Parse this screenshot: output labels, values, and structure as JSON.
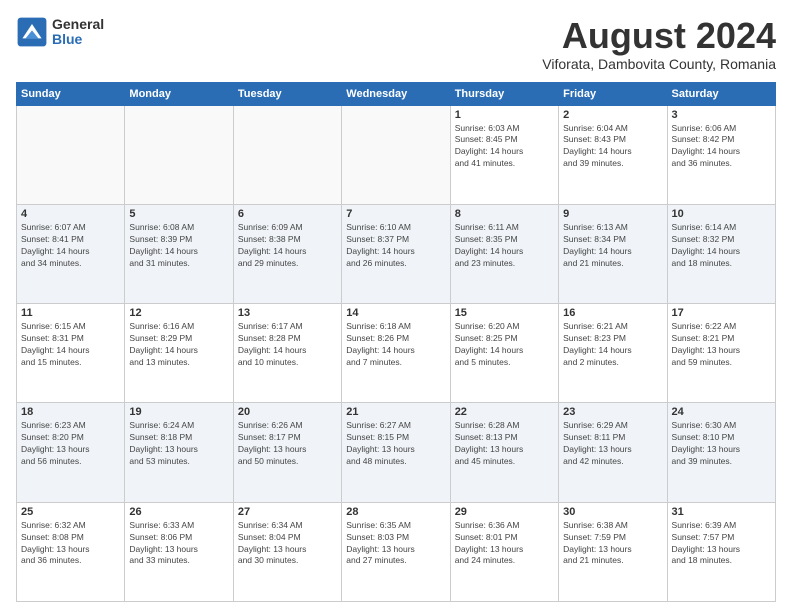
{
  "logo": {
    "general": "General",
    "blue": "Blue"
  },
  "title": "August 2024",
  "subtitle": "Viforata, Dambovita County, Romania",
  "weekdays": [
    "Sunday",
    "Monday",
    "Tuesday",
    "Wednesday",
    "Thursday",
    "Friday",
    "Saturday"
  ],
  "weeks": [
    [
      {
        "day": "",
        "info": ""
      },
      {
        "day": "",
        "info": ""
      },
      {
        "day": "",
        "info": ""
      },
      {
        "day": "",
        "info": ""
      },
      {
        "day": "1",
        "info": "Sunrise: 6:03 AM\nSunset: 8:45 PM\nDaylight: 14 hours\nand 41 minutes."
      },
      {
        "day": "2",
        "info": "Sunrise: 6:04 AM\nSunset: 8:43 PM\nDaylight: 14 hours\nand 39 minutes."
      },
      {
        "day": "3",
        "info": "Sunrise: 6:06 AM\nSunset: 8:42 PM\nDaylight: 14 hours\nand 36 minutes."
      }
    ],
    [
      {
        "day": "4",
        "info": "Sunrise: 6:07 AM\nSunset: 8:41 PM\nDaylight: 14 hours\nand 34 minutes."
      },
      {
        "day": "5",
        "info": "Sunrise: 6:08 AM\nSunset: 8:39 PM\nDaylight: 14 hours\nand 31 minutes."
      },
      {
        "day": "6",
        "info": "Sunrise: 6:09 AM\nSunset: 8:38 PM\nDaylight: 14 hours\nand 29 minutes."
      },
      {
        "day": "7",
        "info": "Sunrise: 6:10 AM\nSunset: 8:37 PM\nDaylight: 14 hours\nand 26 minutes."
      },
      {
        "day": "8",
        "info": "Sunrise: 6:11 AM\nSunset: 8:35 PM\nDaylight: 14 hours\nand 23 minutes."
      },
      {
        "day": "9",
        "info": "Sunrise: 6:13 AM\nSunset: 8:34 PM\nDaylight: 14 hours\nand 21 minutes."
      },
      {
        "day": "10",
        "info": "Sunrise: 6:14 AM\nSunset: 8:32 PM\nDaylight: 14 hours\nand 18 minutes."
      }
    ],
    [
      {
        "day": "11",
        "info": "Sunrise: 6:15 AM\nSunset: 8:31 PM\nDaylight: 14 hours\nand 15 minutes."
      },
      {
        "day": "12",
        "info": "Sunrise: 6:16 AM\nSunset: 8:29 PM\nDaylight: 14 hours\nand 13 minutes."
      },
      {
        "day": "13",
        "info": "Sunrise: 6:17 AM\nSunset: 8:28 PM\nDaylight: 14 hours\nand 10 minutes."
      },
      {
        "day": "14",
        "info": "Sunrise: 6:18 AM\nSunset: 8:26 PM\nDaylight: 14 hours\nand 7 minutes."
      },
      {
        "day": "15",
        "info": "Sunrise: 6:20 AM\nSunset: 8:25 PM\nDaylight: 14 hours\nand 5 minutes."
      },
      {
        "day": "16",
        "info": "Sunrise: 6:21 AM\nSunset: 8:23 PM\nDaylight: 14 hours\nand 2 minutes."
      },
      {
        "day": "17",
        "info": "Sunrise: 6:22 AM\nSunset: 8:21 PM\nDaylight: 13 hours\nand 59 minutes."
      }
    ],
    [
      {
        "day": "18",
        "info": "Sunrise: 6:23 AM\nSunset: 8:20 PM\nDaylight: 13 hours\nand 56 minutes."
      },
      {
        "day": "19",
        "info": "Sunrise: 6:24 AM\nSunset: 8:18 PM\nDaylight: 13 hours\nand 53 minutes."
      },
      {
        "day": "20",
        "info": "Sunrise: 6:26 AM\nSunset: 8:17 PM\nDaylight: 13 hours\nand 50 minutes."
      },
      {
        "day": "21",
        "info": "Sunrise: 6:27 AM\nSunset: 8:15 PM\nDaylight: 13 hours\nand 48 minutes."
      },
      {
        "day": "22",
        "info": "Sunrise: 6:28 AM\nSunset: 8:13 PM\nDaylight: 13 hours\nand 45 minutes."
      },
      {
        "day": "23",
        "info": "Sunrise: 6:29 AM\nSunset: 8:11 PM\nDaylight: 13 hours\nand 42 minutes."
      },
      {
        "day": "24",
        "info": "Sunrise: 6:30 AM\nSunset: 8:10 PM\nDaylight: 13 hours\nand 39 minutes."
      }
    ],
    [
      {
        "day": "25",
        "info": "Sunrise: 6:32 AM\nSunset: 8:08 PM\nDaylight: 13 hours\nand 36 minutes."
      },
      {
        "day": "26",
        "info": "Sunrise: 6:33 AM\nSunset: 8:06 PM\nDaylight: 13 hours\nand 33 minutes."
      },
      {
        "day": "27",
        "info": "Sunrise: 6:34 AM\nSunset: 8:04 PM\nDaylight: 13 hours\nand 30 minutes."
      },
      {
        "day": "28",
        "info": "Sunrise: 6:35 AM\nSunset: 8:03 PM\nDaylight: 13 hours\nand 27 minutes."
      },
      {
        "day": "29",
        "info": "Sunrise: 6:36 AM\nSunset: 8:01 PM\nDaylight: 13 hours\nand 24 minutes."
      },
      {
        "day": "30",
        "info": "Sunrise: 6:38 AM\nSunset: 7:59 PM\nDaylight: 13 hours\nand 21 minutes."
      },
      {
        "day": "31",
        "info": "Sunrise: 6:39 AM\nSunset: 7:57 PM\nDaylight: 13 hours\nand 18 minutes."
      }
    ]
  ]
}
